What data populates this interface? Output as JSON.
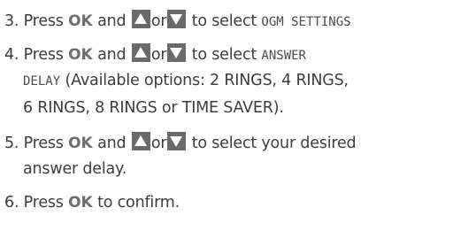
{
  "steps": [
    {
      "num": "3.",
      "pre": "Press",
      "ok": "OK",
      "and": "and",
      "or": "or",
      "mid": "to select",
      "code": "OGM SETTINGS",
      "up_icon": "up-arrow-key",
      "down_icon": "down-arrow-key"
    },
    {
      "num": "4.",
      "pre": "Press",
      "ok": "OK",
      "and": "and",
      "or": "or",
      "mid": "to select",
      "code1": "ANSWER",
      "code2": "DELAY",
      "options": "(Available options: 2 RINGS, 4 RINGS,",
      "options_cont": "6 RINGS, 8 RINGS or TIME SAVER).",
      "up_icon": "up-arrow-key",
      "down_icon": "down-arrow-key"
    },
    {
      "num": "5.",
      "pre": "Press",
      "ok": "OK",
      "and": "and",
      "or": "or",
      "mid": "to select your desired",
      "cont": "answer delay.",
      "up_icon": "up-arrow-key",
      "down_icon": "down-arrow-key"
    },
    {
      "num": "6.",
      "pre": "Press",
      "ok": "OK",
      "post": "to confirm."
    }
  ]
}
